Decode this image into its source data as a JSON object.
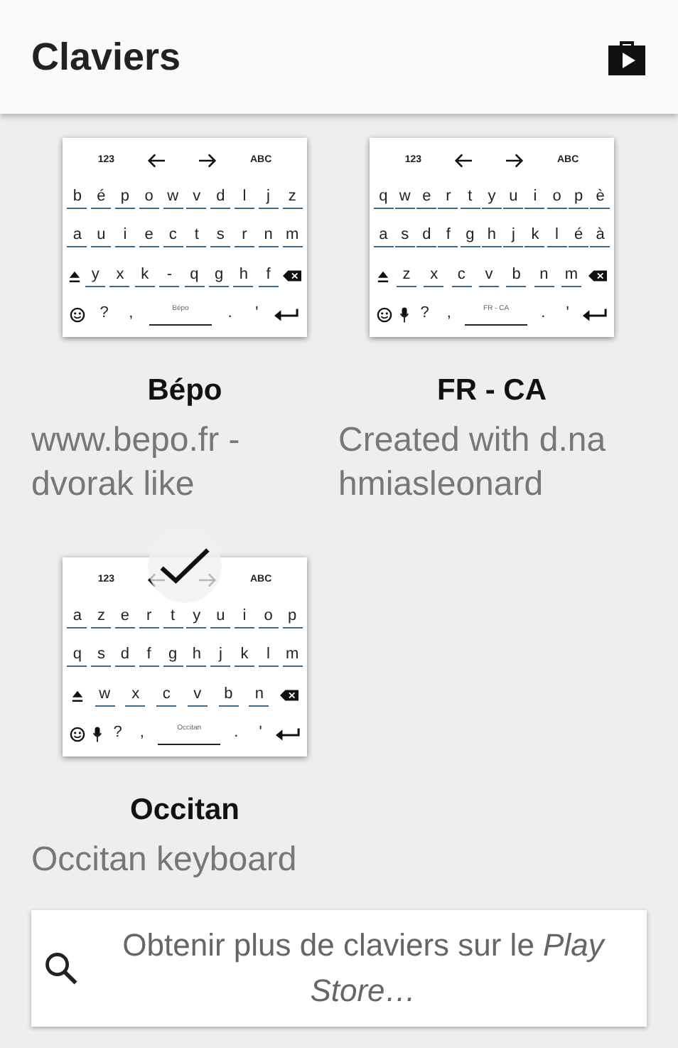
{
  "header": {
    "title": "Claviers"
  },
  "keyboards": [
    {
      "name": "Bépo",
      "description": "www.bepo.fr - dvorak like",
      "selected": false,
      "toolbar": [
        "123",
        {
          "kind": "left"
        },
        {
          "kind": "right"
        },
        "ABC"
      ],
      "keys": [
        [
          "b",
          "é",
          "p",
          "o",
          "w",
          "v",
          "d",
          "l",
          "j",
          "z"
        ],
        [
          "a",
          "u",
          "i",
          "e",
          "c",
          "t",
          "s",
          "r",
          "n",
          "m"
        ],
        [
          {
            "kind": "shift"
          },
          "y",
          "x",
          "k",
          "-",
          "q",
          "g",
          "h",
          "f",
          {
            "kind": "backspace"
          }
        ],
        [
          {
            "kind": "emoji"
          },
          "?",
          ",",
          {
            "kind": "space",
            "label": "Bépo"
          },
          ".",
          "'",
          {
            "kind": "enter"
          }
        ]
      ]
    },
    {
      "name": "FR - CA",
      "description": "Created with d.na hmiasleonard",
      "selected": false,
      "toolbar": [
        "123",
        {
          "kind": "left"
        },
        {
          "kind": "right"
        },
        "ABC"
      ],
      "keys": [
        [
          "q",
          "w",
          "e",
          "r",
          "t",
          "y",
          "u",
          "i",
          "o",
          "p",
          "è"
        ],
        [
          "a",
          "s",
          "d",
          "f",
          "g",
          "h",
          "j",
          "k",
          "l",
          "é",
          "à"
        ],
        [
          {
            "kind": "shift"
          },
          "z",
          "x",
          "c",
          "v",
          "b",
          "n",
          "m",
          {
            "kind": "backspace"
          }
        ],
        [
          {
            "kind": "emoji"
          },
          {
            "kind": "mic"
          },
          "?",
          ",",
          {
            "kind": "space",
            "label": "FR - CA"
          },
          ".",
          "'",
          {
            "kind": "enter"
          }
        ]
      ]
    },
    {
      "name": "Occitan",
      "description": "Occitan keyboard",
      "selected": true,
      "toolbar": [
        "123",
        {
          "kind": "left"
        },
        {
          "kind": "right"
        },
        "ABC"
      ],
      "keys": [
        [
          "a",
          "z",
          "e",
          "r",
          "t",
          "y",
          "u",
          "i",
          "o",
          "p"
        ],
        [
          "q",
          "s",
          "d",
          "f",
          "g",
          "h",
          "j",
          "k",
          "l",
          "m"
        ],
        [
          {
            "kind": "shift"
          },
          "w",
          "x",
          "c",
          "v",
          "b",
          "n",
          {
            "kind": "backspace"
          }
        ],
        [
          {
            "kind": "emoji"
          },
          {
            "kind": "mic"
          },
          "?",
          ",",
          {
            "kind": "space",
            "label": "Occitan"
          },
          ".",
          "'",
          {
            "kind": "enter"
          }
        ]
      ]
    }
  ],
  "search": {
    "text": "Obtenir plus de claviers sur le *Play Store…*"
  }
}
